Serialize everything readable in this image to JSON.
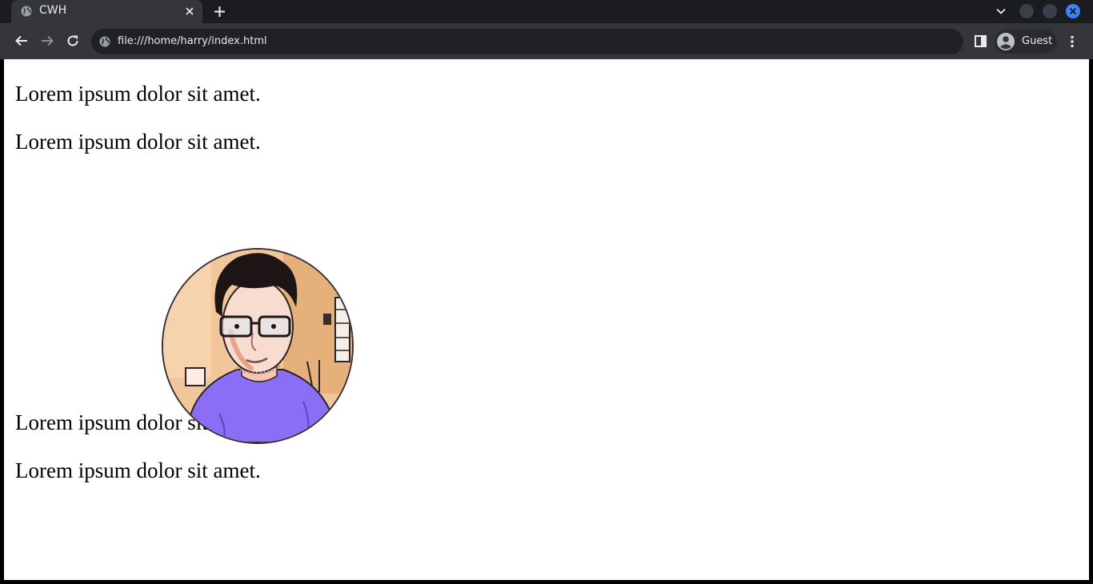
{
  "browser": {
    "tab": {
      "title": "CWH",
      "favicon": "globe-icon",
      "close_icon": "close-icon"
    },
    "new_tab_icon": "plus-icon",
    "tab_search_icon": "chevron-down-icon",
    "window_controls": [
      "minimize",
      "maximize",
      "close"
    ],
    "toolbar": {
      "back_icon": "arrow-left-icon",
      "forward_icon": "arrow-right-icon",
      "reload_icon": "reload-icon",
      "site_info_icon": "globe-icon",
      "url": "file:///home/harry/index.html",
      "side_panel_icon": "side-panel-icon",
      "profile_label": "Guest",
      "menu_icon": "kebab-menu-icon"
    },
    "colors": {
      "tabstrip": "#1b1c1f",
      "toolbar": "#35363a",
      "omnibox": "#202124",
      "close_accent": "#3d82f5"
    }
  },
  "page": {
    "paragraphs": [
      "Lorem ipsum dolor sit amet.",
      "Lorem ipsum dolor sit amet.",
      "Lorem ipsum dolor sit amet.",
      "Lorem ipsum dolor sit amet."
    ],
    "image": {
      "shape": "circle",
      "subject": "cartoon-portrait"
    }
  }
}
